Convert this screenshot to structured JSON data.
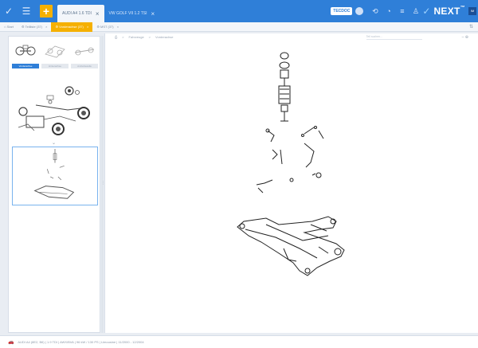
{
  "header": {
    "tabs": [
      {
        "label": "AUDI A4 1.6 TDI",
        "active": true
      },
      {
        "label": "VW GOLF VII 1.2 TSI",
        "active": false
      }
    ],
    "badge": "TECDOC",
    "logo": "NEXT",
    "logo_mark": "™",
    "logo_sub": "IM"
  },
  "subtabs": [
    {
      "label": "Start",
      "active": false
    },
    {
      "label": "Teilliste (37)",
      "active": false
    },
    {
      "label": "Vorderachse (37)",
      "active": true
    },
    {
      "label": "MST (37)",
      "active": false
    }
  ],
  "groups": [
    {
      "label": "Vorderachse",
      "active": true
    },
    {
      "label": "Hinterachse",
      "active": false
    },
    {
      "label": "Antriebswelle",
      "active": false
    }
  ],
  "breadcrumb": [
    "Fahrzeuge",
    "Vorderachse"
  ],
  "search": {
    "placeholder": "Teil suchen..."
  },
  "status": {
    "text": "AUDI A4 (8E2, B6) | 1.9 TDI | AWX/BVA | 96 kW / 130 PS | Limousine | 11/2000 - 12/2004"
  },
  "colors": {
    "primary": "#2f7fd8",
    "accent": "#f5b000"
  }
}
